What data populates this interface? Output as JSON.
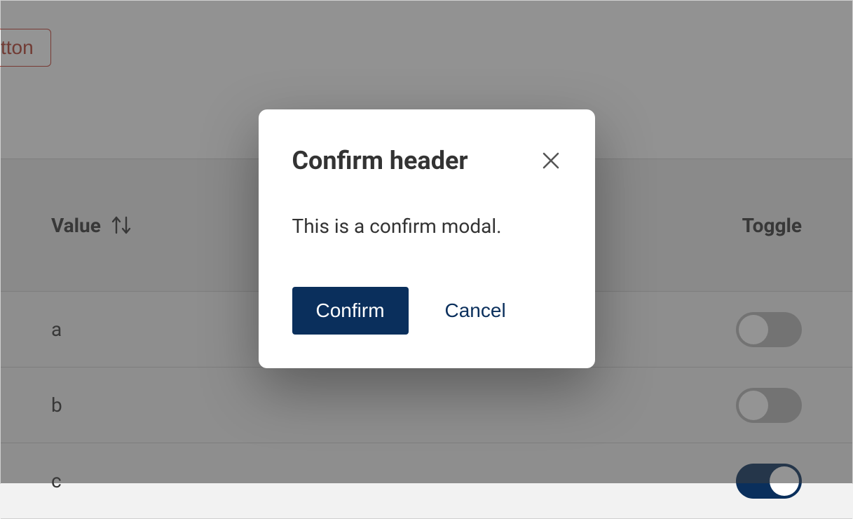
{
  "top_button_label": "tton",
  "table": {
    "columns": {
      "value": "Value",
      "toggle": "Toggle"
    },
    "rows": [
      {
        "value": "a",
        "toggle": false
      },
      {
        "value": "b",
        "toggle": false
      },
      {
        "value": "c",
        "toggle": true
      }
    ]
  },
  "modal": {
    "title": "Confirm header",
    "body": "This is a confirm modal.",
    "confirm_label": "Confirm",
    "cancel_label": "Cancel"
  }
}
